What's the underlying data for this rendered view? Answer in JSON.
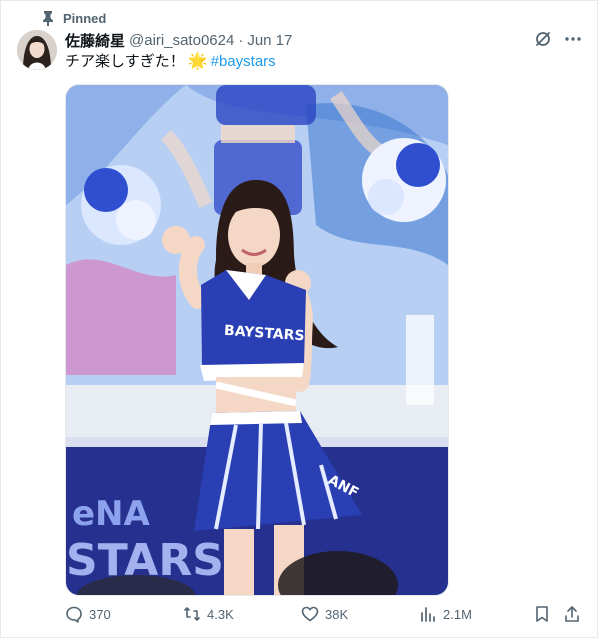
{
  "pinned": {
    "label": "Pinned"
  },
  "author": {
    "display_name": "佐藤綺星",
    "handle": "@airi_sato0624",
    "separator": "·",
    "date": "Jun 17"
  },
  "tweet": {
    "text": "チア楽しすぎた！",
    "emoji": "🌟",
    "hashtag": "#baystars"
  },
  "media": {
    "alt": "Cheerleader in blue BAYSTARS uniform posing on stage with pom-poms",
    "uniform_lettering": "BAYSTARS",
    "skirt_lettering": "ANF",
    "banner_lettering_top": "eNA",
    "banner_lettering_bottom": "STARS"
  },
  "actions": {
    "replies": "370",
    "reposts": "4.3K",
    "likes": "38K",
    "views": "2.1M"
  },
  "colors": {
    "text_primary": "#0f1419",
    "text_secondary": "#536471",
    "link": "#1d9bf0",
    "uniform_blue": "#2a3fb4"
  }
}
